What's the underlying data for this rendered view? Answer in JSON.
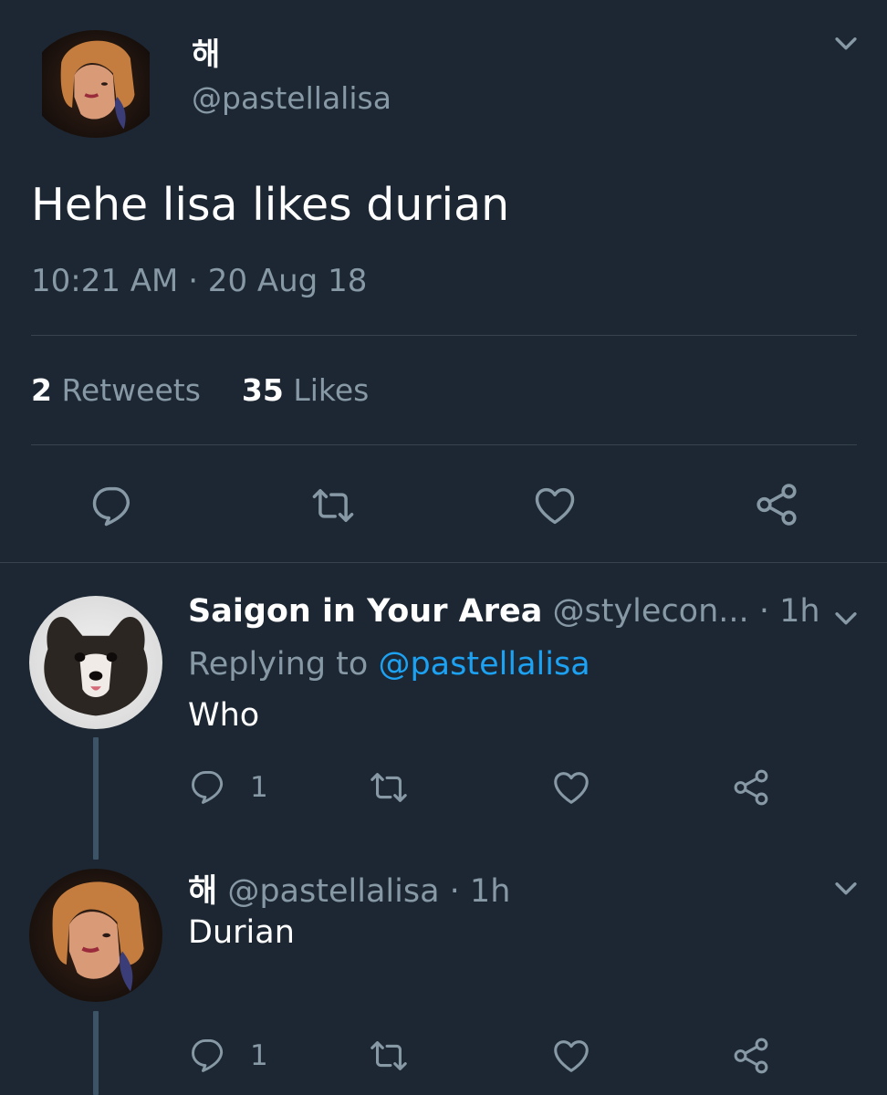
{
  "main_tweet": {
    "display_name": "해",
    "handle": "@pastellalisa",
    "text": "Hehe lisa likes durian",
    "timestamp": "10:21 AM · 20 Aug 18",
    "retweets_count": "2",
    "retweets_label": "Retweets",
    "likes_count": "35",
    "likes_label": "Likes"
  },
  "replies": [
    {
      "display_name": "Saigon in Your Area",
      "handle": "@stylecon...",
      "time": "· 1h",
      "replying_prefix": "Replying to",
      "replying_handle": "@pastellalisa",
      "text": "Who",
      "reply_count": "1"
    },
    {
      "display_name": "해",
      "handle": "@pastellalisa",
      "time": "· 1h",
      "text": "Durian",
      "reply_count": "1"
    }
  ],
  "icons": {
    "reply": "reply-icon",
    "retweet": "retweet-icon",
    "like": "heart-icon",
    "share": "share-icon",
    "menu": "chevron-down-icon"
  },
  "colors": {
    "background": "#1c2733",
    "muted_text": "#8899a6",
    "link": "#1da1f2",
    "divider": "#38444d"
  }
}
